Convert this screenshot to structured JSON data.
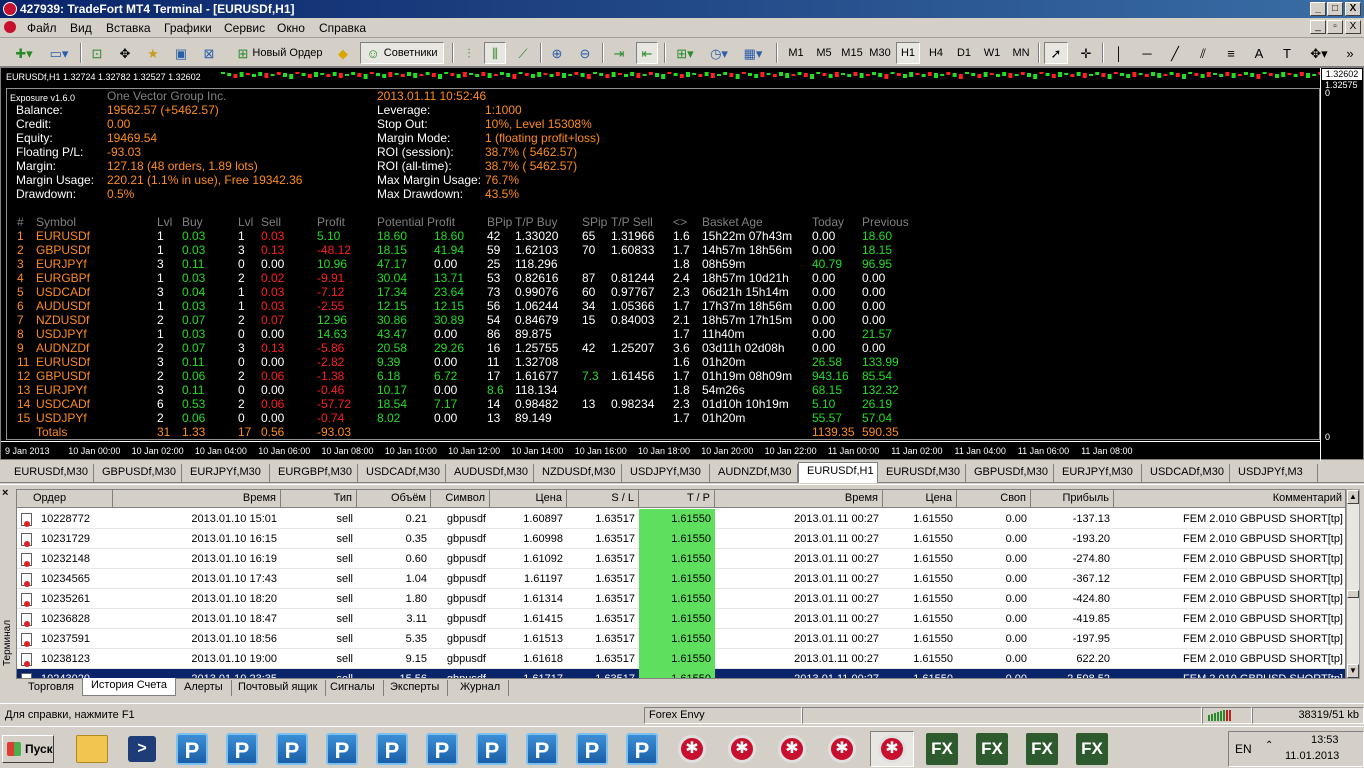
{
  "app": {
    "title": "427939: TradeFort MT4 Terminal - [EURUSDf,H1]",
    "window_buttons": [
      "_",
      "□",
      "X"
    ],
    "mdi_buttons": [
      "_",
      "▫",
      "X"
    ]
  },
  "menu": [
    "Файл",
    "Вид",
    "Вставка",
    "Графики",
    "Сервис",
    "Окно",
    "Справка"
  ],
  "toolbar": {
    "new_order": "Новый Ордер",
    "advisors": "Советники",
    "periods": [
      "M1",
      "M5",
      "M15",
      "M30",
      "H1",
      "H4",
      "D1",
      "W1",
      "MN"
    ],
    "active_period": "H1"
  },
  "chart": {
    "symbol_line": "EURUSDf,H1  1.32724 1.32782 1.32527 1.32602",
    "price_box": "1.32602",
    "scale_top": "1.32575",
    "scale_bottom": "0",
    "scale_zero": "0",
    "time_ticks": [
      "9 Jan 2013",
      "10 Jan 00:00",
      "10 Jan 02:00",
      "10 Jan 04:00",
      "10 Jan 06:00",
      "10 Jan 08:00",
      "10 Jan 10:00",
      "10 Jan 12:00",
      "10 Jan 14:00",
      "10 Jan 16:00",
      "10 Jan 18:00",
      "10 Jan 20:00",
      "10 Jan 22:00",
      "11 Jan 00:00",
      "11 Jan 02:00",
      "11 Jan 04:00",
      "11 Jan 06:00",
      "11 Jan 08:00"
    ]
  },
  "exposure": {
    "version": "Exposure v1.6.0",
    "company": "One Vector Group Inc.",
    "datetime": "2013.01.11 10:52:46",
    "left": [
      {
        "label": "Balance:",
        "value": "19562.57 (+5462.57)"
      },
      {
        "label": "Credit:",
        "value": "0.00"
      },
      {
        "label": "Equity:",
        "value": "19469.54"
      },
      {
        "label": "Floating P/L:",
        "value": "-93.03"
      },
      {
        "label": "Margin:",
        "value": "127.18 (48 orders, 1.89 lots)"
      },
      {
        "label": "Margin Usage:",
        "value": "220.21 (1.1% in use), Free 19342.36"
      },
      {
        "label": "Drawdown:",
        "value": "0.5%"
      }
    ],
    "right": [
      {
        "label": "Leverage:",
        "value": "1:1000"
      },
      {
        "label": "Stop Out:",
        "value": "10%, Level 15308%"
      },
      {
        "label": "Margin Mode:",
        "value": "1 (floating profit+loss)"
      },
      {
        "label": "ROI (session):",
        "value": "38.7% ( 5462.57)"
      },
      {
        "label": "ROI (all-time):",
        "value": "38.7% ( 5462.57)"
      },
      {
        "label": "Max Margin Usage:",
        "value": "76.7%"
      },
      {
        "label": "Max Drawdown:",
        "value": "43.5%"
      }
    ],
    "headers": [
      "#",
      "Symbol",
      "Lvl",
      "Buy",
      "Lvl",
      "Sell",
      "Profit",
      "Potential Profit",
      "BPip",
      "T/P Buy",
      "SPip",
      "T/P Sell",
      "<>",
      "Basket Age",
      "Today",
      "Previous"
    ],
    "rows": [
      [
        "1",
        "EURUSDf",
        "1",
        "0.03",
        "1",
        "0.03",
        "5.10",
        "18.60",
        "18.60",
        "42",
        "1.33020",
        "65",
        "1.31966",
        "1.6",
        "15h22m 07h43m",
        "0.00",
        "18.60"
      ],
      [
        "2",
        "GBPUSDf",
        "1",
        "0.03",
        "3",
        "0.13",
        "-48.12",
        "18.15",
        "41.94",
        "59",
        "1.62103",
        "70",
        "1.60833",
        "1.7",
        "14h57m 18h56m",
        "0.00",
        "18.15"
      ],
      [
        "3",
        "EURJPYf",
        "3",
        "0.11",
        "0",
        "0.00",
        "10.96",
        "47.17",
        "0.00",
        "25",
        "118.296",
        "",
        "",
        "1.8",
        "08h59m",
        "40.79",
        "96.95"
      ],
      [
        "4",
        "EURGBPf",
        "1",
        "0.03",
        "2",
        "0.02",
        "-9.91",
        "30.04",
        "13.71",
        "53",
        "0.82616",
        "87",
        "0.81244",
        "2.4",
        "18h57m 10d21h",
        "0.00",
        "0.00"
      ],
      [
        "5",
        "USDCADf",
        "3",
        "0.04",
        "1",
        "0.03",
        "-7.12",
        "17.34",
        "23.64",
        "73",
        "0.99076",
        "60",
        "0.97767",
        "2.3",
        "06d21h 15h14m",
        "0.00",
        "0.00"
      ],
      [
        "6",
        "AUDUSDf",
        "1",
        "0.03",
        "1",
        "0.03",
        "-2.55",
        "12.15",
        "12.15",
        "56",
        "1.06244",
        "34",
        "1.05366",
        "1.7",
        "17h37m 18h56m",
        "0.00",
        "0.00"
      ],
      [
        "7",
        "NZDUSDf",
        "2",
        "0.07",
        "2",
        "0.07",
        "12.96",
        "30.86",
        "30.89",
        "54",
        "0.84679",
        "15",
        "0.84003",
        "2.1",
        "18h57m 17h15m",
        "0.00",
        "0.00"
      ],
      [
        "8",
        "USDJPYf",
        "1",
        "0.03",
        "0",
        "0.00",
        "14.63",
        "43.47",
        "0.00",
        "86",
        "89.875",
        "",
        "",
        "1.7",
        "11h40m",
        "0.00",
        "21.57"
      ],
      [
        "9",
        "AUDNZDf",
        "2",
        "0.07",
        "3",
        "0.13",
        "-5.86",
        "20.58",
        "29.26",
        "16",
        "1.25755",
        "42",
        "1.25207",
        "3.6",
        "03d11h 02d08h",
        "0.00",
        "0.00"
      ],
      [
        "11",
        "EURUSDf",
        "3",
        "0.11",
        "0",
        "0.00",
        "-2.82",
        "9.39",
        "0.00",
        "11",
        "1.32708",
        "",
        "",
        "1.6",
        "01h20m",
        "26.58",
        "133.99"
      ],
      [
        "12",
        "GBPUSDf",
        "2",
        "0.06",
        "2",
        "0.06",
        "-1.38",
        "6.18",
        "6.72",
        "17",
        "1.61677",
        "7.3",
        "1.61456",
        "1.7",
        "01h19m 08h09m",
        "943.16",
        "85.54"
      ],
      [
        "13",
        "EURJPYf",
        "3",
        "0.11",
        "0",
        "0.00",
        "-0.46",
        "10.17",
        "0.00",
        "8.6",
        "118.134",
        "",
        "",
        "1.8",
        "54m26s",
        "68.15",
        "132.32"
      ],
      [
        "14",
        "USDCADf",
        "6",
        "0.53",
        "2",
        "0.06",
        "-57.72",
        "18.54",
        "7.17",
        "14",
        "0.98482",
        "13",
        "0.98234",
        "2.3",
        "01d10h 10h19m",
        "5.10",
        "26.19"
      ],
      [
        "15",
        "USDJPYf",
        "2",
        "0.06",
        "0",
        "0.00",
        "-0.74",
        "8.02",
        "0.00",
        "13",
        "89.149",
        "",
        "",
        "1.7",
        "01h20m",
        "55.57",
        "57.04"
      ]
    ],
    "totals": {
      "label": "Totals",
      "buy_lvl": "31",
      "buy": "1.33",
      "sell_lvl": "17",
      "sell": "0.56",
      "profit": "-93.03",
      "today": "1139.35",
      "previous": "590.35"
    }
  },
  "chart_tabs": [
    "EURUSDf,M30",
    "GBPUSDf,M30",
    "EURJPYf,M30",
    "EURGBPf,M30",
    "USDCADf,M30",
    "AUDUSDf,M30",
    "NZDUSDf,M30",
    "USDJPYf,M30",
    "AUDNZDf,M30",
    "EURUSDf,H1",
    "EURUSDf,M30",
    "GBPUSDf,M30",
    "EURJPYf,M30",
    "USDCADf,M30",
    "USDJPYf,M3"
  ],
  "active_chart_tab": "EURUSDf,H1",
  "terminal": {
    "label": "Терминал",
    "close": "×",
    "columns": [
      "Ордер",
      "Время",
      "Тип",
      "Объём",
      "Символ",
      "Цена",
      "S / L",
      "T / P",
      "Время",
      "Цена",
      "Своп",
      "Прибыль",
      "Комментарий"
    ],
    "rows": [
      [
        "10228772",
        "2013.01.10 15:01",
        "sell",
        "0.21",
        "gbpusdf",
        "1.60897",
        "1.63517",
        "1.61550",
        "2013.01.11 00:27",
        "1.61550",
        "0.00",
        "-137.13",
        "FEM 2.010 GBPUSD SHORT[tp]"
      ],
      [
        "10231729",
        "2013.01.10 16:15",
        "sell",
        "0.35",
        "gbpusdf",
        "1.60998",
        "1.63517",
        "1.61550",
        "2013.01.11 00:27",
        "1.61550",
        "0.00",
        "-193.20",
        "FEM 2.010 GBPUSD SHORT[tp]"
      ],
      [
        "10232148",
        "2013.01.10 16:19",
        "sell",
        "0.60",
        "gbpusdf",
        "1.61092",
        "1.63517",
        "1.61550",
        "2013.01.11 00:27",
        "1.61550",
        "0.00",
        "-274.80",
        "FEM 2.010 GBPUSD SHORT[tp]"
      ],
      [
        "10234565",
        "2013.01.10 17:43",
        "sell",
        "1.04",
        "gbpusdf",
        "1.61197",
        "1.63517",
        "1.61550",
        "2013.01.11 00:27",
        "1.61550",
        "0.00",
        "-367.12",
        "FEM 2.010 GBPUSD SHORT[tp]"
      ],
      [
        "10235261",
        "2013.01.10 18:20",
        "sell",
        "1.80",
        "gbpusdf",
        "1.61314",
        "1.63517",
        "1.61550",
        "2013.01.11 00:27",
        "1.61550",
        "0.00",
        "-424.80",
        "FEM 2.010 GBPUSD SHORT[tp]"
      ],
      [
        "10236828",
        "2013.01.10 18:47",
        "sell",
        "3.11",
        "gbpusdf",
        "1.61415",
        "1.63517",
        "1.61550",
        "2013.01.11 00:27",
        "1.61550",
        "0.00",
        "-419.85",
        "FEM 2.010 GBPUSD SHORT[tp]"
      ],
      [
        "10237591",
        "2013.01.10 18:56",
        "sell",
        "5.35",
        "gbpusdf",
        "1.61513",
        "1.63517",
        "1.61550",
        "2013.01.11 00:27",
        "1.61550",
        "0.00",
        "-197.95",
        "FEM 2.010 GBPUSD SHORT[tp]"
      ],
      [
        "10238123",
        "2013.01.10 19:00",
        "sell",
        "9.15",
        "gbpusdf",
        "1.61618",
        "1.63517",
        "1.61550",
        "2013.01.11 00:27",
        "1.61550",
        "0.00",
        "622.20",
        "FEM 2.010 GBPUSD SHORT[tp]"
      ],
      [
        "10243020",
        "2013.01.10 23:35",
        "sell",
        "15.56",
        "gbpusdf",
        "1.61717",
        "1.63517",
        "1.61550",
        "2013.01.11 00:27",
        "1.61550",
        "0.00",
        "2 598.52",
        "FEM 2.010 GBPUSD SHORT[tp]"
      ]
    ],
    "selected_row": 8,
    "tabs": [
      "Торговля",
      "История Счета",
      "Алерты",
      "Почтовый ящик",
      "Сигналы",
      "Эксперты",
      "Журнал"
    ],
    "active_tab": "История Счета"
  },
  "status": {
    "help": "Для справки, нажмите F1",
    "profile": "Forex Envy",
    "traffic": "38319/51 kb"
  },
  "taskbar": {
    "start": "Пуск",
    "lang": "EN",
    "time": "13:53",
    "date": "11.01.2013",
    "apps": [
      "folder",
      "powershell",
      "P",
      "P",
      "P",
      "P",
      "P",
      "P",
      "P",
      "P",
      "P",
      "P",
      "star",
      "star",
      "star",
      "star",
      "star",
      "fx",
      "fx",
      "fx",
      "fx"
    ],
    "active_app": 16
  },
  "colors": {
    "labels": "#ffffff",
    "values_orange": "#ff8c1a",
    "negative": "#ff1e1e",
    "positive": "#22dd22",
    "tp_cell": "#5ee05e",
    "selection": "#0a246a"
  }
}
